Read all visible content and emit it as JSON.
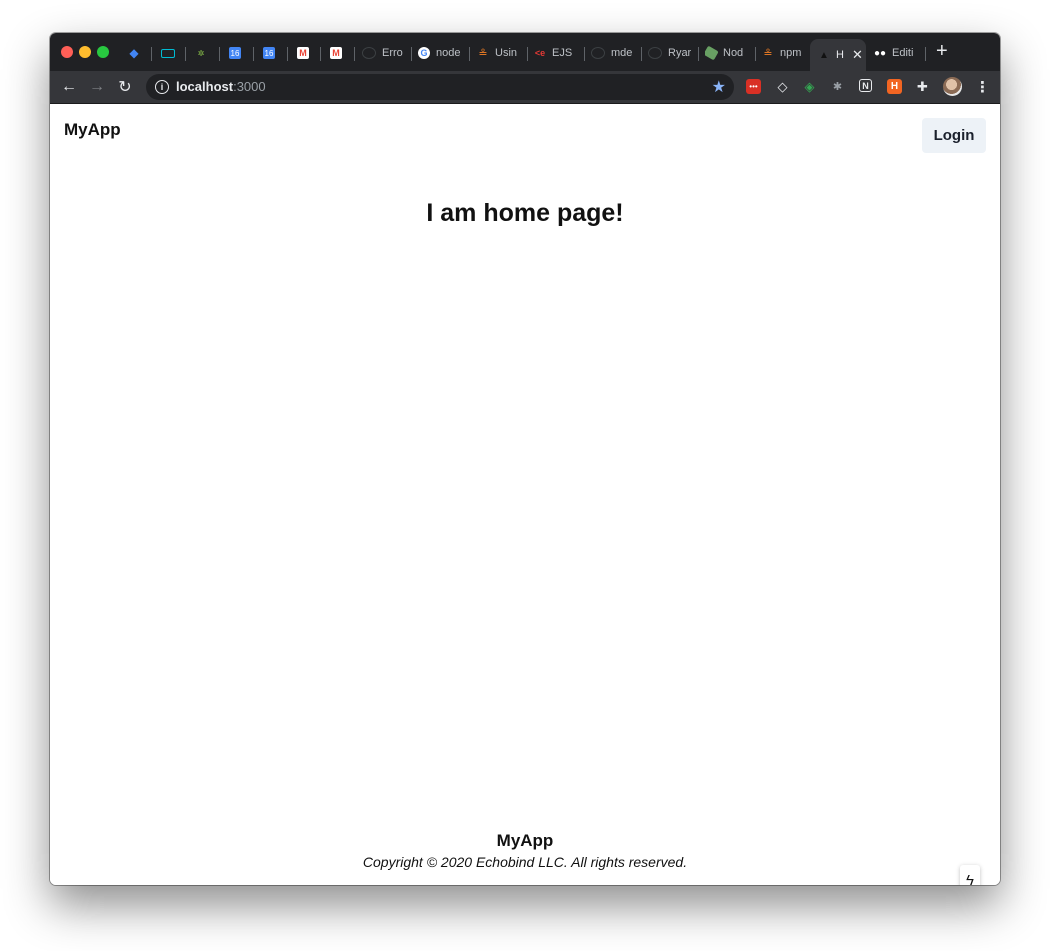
{
  "browser": {
    "tabs": [
      {
        "label": "",
        "icon": "gem-icon",
        "color": "#4285f4"
      },
      {
        "label": "",
        "icon": "screen-icon",
        "color": "#00bcd4"
      },
      {
        "label": "",
        "icon": "sparkle-icon",
        "color": "#8bc34a"
      },
      {
        "label": "",
        "icon": "calendar-icon",
        "color": "#4285f4",
        "glyph": "16"
      },
      {
        "label": "",
        "icon": "calendar-icon",
        "color": "#4285f4",
        "glyph": "16"
      },
      {
        "label": "",
        "icon": "gmail-icon",
        "color": "#ea4335"
      },
      {
        "label": "",
        "icon": "gmail-icon",
        "color": "#ea4335"
      },
      {
        "label": "Erro",
        "icon": "github-icon",
        "color": "#3c4043"
      },
      {
        "label": "node",
        "icon": "google-icon",
        "color": "#ffffff"
      },
      {
        "label": "Usin",
        "icon": "stackoverflow-icon",
        "color": "#f48024"
      },
      {
        "label": "EJS",
        "icon": "ejs-icon",
        "color": "#b4ca65"
      },
      {
        "label": "mde",
        "icon": "github-icon",
        "color": "#3c4043"
      },
      {
        "label": "Ryar",
        "icon": "github-icon",
        "color": "#3c4043"
      },
      {
        "label": "Nod",
        "icon": "nodejs-icon",
        "color": "#68a063"
      },
      {
        "label": "npm",
        "icon": "stackoverflow-icon",
        "color": "#f48024"
      },
      {
        "label": "H",
        "icon": "drop-icon",
        "color": "#111111",
        "active": true
      },
      {
        "label": "Editi",
        "icon": "medium-icon",
        "color": "#ffffff"
      }
    ],
    "address": {
      "host": "localhost",
      "port": ":3000"
    }
  },
  "app": {
    "brand": "MyApp",
    "login_label": "Login",
    "heading": "I am home page!",
    "footer_brand": "MyApp",
    "footer_copyright": "Copyright © 2020 Echobind LLC. All rights reserved."
  },
  "colors": {
    "login_bg": "#edf2f7",
    "tab_strip": "#202124",
    "toolbar": "#35363a"
  }
}
